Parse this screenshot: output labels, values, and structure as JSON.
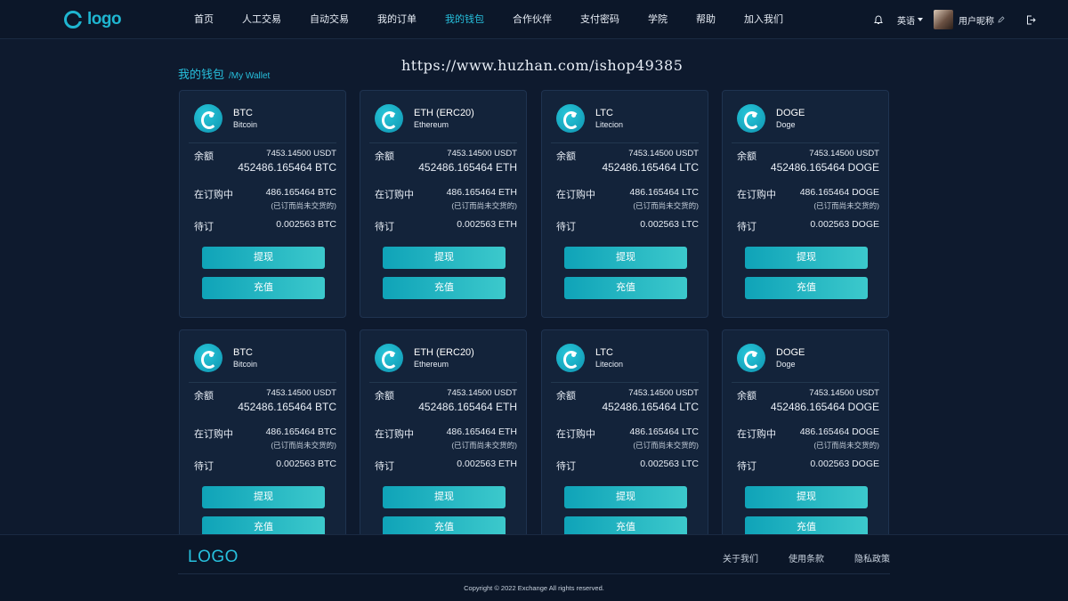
{
  "header": {
    "logo_text": "logo",
    "nav": [
      {
        "label": "首页",
        "active": false
      },
      {
        "label": "人工交易",
        "active": false
      },
      {
        "label": "自动交易",
        "active": false
      },
      {
        "label": "我的订单",
        "active": false
      },
      {
        "label": "我的钱包",
        "active": true
      },
      {
        "label": "合作伙伴",
        "active": false
      },
      {
        "label": "支付密码",
        "active": false
      },
      {
        "label": "学院",
        "active": false
      },
      {
        "label": "帮助",
        "active": false
      },
      {
        "label": "加入我们",
        "active": false
      }
    ],
    "language": "英语",
    "username": "用户昵称"
  },
  "watermark": "https://www.huzhan.com/ishop49385",
  "page_title": {
    "cn": "我的钱包",
    "en": "/My Wallet"
  },
  "labels": {
    "balance": "余额",
    "in_order": "在订购中",
    "pending": "待订",
    "withdraw": "提现",
    "deposit": "充值"
  },
  "wallets": [
    {
      "symbol": "BTC",
      "name": "Bitcoin",
      "balance_usdt": "7453.14500 USDT",
      "balance_coin": "452486.165464 BTC",
      "in_order": "486.165464 BTC",
      "in_order_note": "(已订而尚未交货的)",
      "pending": "0.002563 BTC"
    },
    {
      "symbol": "ETH (ERC20)",
      "name": "Ethereum",
      "balance_usdt": "7453.14500 USDT",
      "balance_coin": "452486.165464 ETH",
      "in_order": "486.165464 ETH",
      "in_order_note": "(已订而尚未交货的)",
      "pending": "0.002563 ETH"
    },
    {
      "symbol": "LTC",
      "name": "Litecion",
      "balance_usdt": "7453.14500 USDT",
      "balance_coin": "452486.165464 LTC",
      "in_order": "486.165464 LTC",
      "in_order_note": "(已订而尚未交货的)",
      "pending": "0.002563 LTC"
    },
    {
      "symbol": "DOGE",
      "name": "Doge",
      "balance_usdt": "7453.14500 USDT",
      "balance_coin": "452486.165464 DOGE",
      "in_order": "486.165464 DOGE",
      "in_order_note": "(已订而尚未交货的)",
      "pending": "0.002563 DOGE"
    },
    {
      "symbol": "BTC",
      "name": "Bitcoin",
      "balance_usdt": "7453.14500 USDT",
      "balance_coin": "452486.165464 BTC",
      "in_order": "486.165464 BTC",
      "in_order_note": "(已订而尚未交货的)",
      "pending": "0.002563 BTC"
    },
    {
      "symbol": "ETH (ERC20)",
      "name": "Ethereum",
      "balance_usdt": "7453.14500 USDT",
      "balance_coin": "452486.165464 ETH",
      "in_order": "486.165464 ETH",
      "in_order_note": "(已订而尚未交货的)",
      "pending": "0.002563 ETH"
    },
    {
      "symbol": "LTC",
      "name": "Litecion",
      "balance_usdt": "7453.14500 USDT",
      "balance_coin": "452486.165464 LTC",
      "in_order": "486.165464 LTC",
      "in_order_note": "(已订而尚未交货的)",
      "pending": "0.002563 LTC"
    },
    {
      "symbol": "DOGE",
      "name": "Doge",
      "balance_usdt": "7453.14500 USDT",
      "balance_coin": "452486.165464 DOGE",
      "in_order": "486.165464 DOGE",
      "in_order_note": "(已订而尚未交货的)",
      "pending": "0.002563 DOGE"
    }
  ],
  "footer": {
    "logo_text": "LOGO",
    "links": [
      "关于我们",
      "使用条款",
      "隐私政策"
    ],
    "copyright": "Copyright © 2022 Exchange All rights reserved."
  },
  "colors": {
    "accent": "#27c0dd",
    "background": "#0e1a2e",
    "card": "#13233a",
    "button_from": "#0fa3b8",
    "button_to": "#3cc9cc"
  },
  "icons": [
    "logo-icon",
    "bell-icon",
    "chevron-down-icon",
    "avatar",
    "edit-icon",
    "logout-icon",
    "coin-icon"
  ]
}
